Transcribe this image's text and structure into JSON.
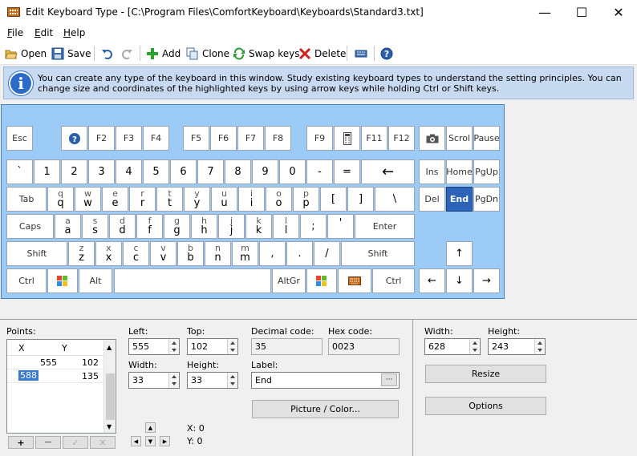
{
  "window": {
    "title": "Edit Keyboard Type - [C:\\Program Files\\ComfortKeyboard\\Keyboards\\Standard3.txt]",
    "minimize": "—",
    "maximize": "☐",
    "close": "✕"
  },
  "menu": {
    "file": "File",
    "edit": "Edit",
    "help": "Help"
  },
  "toolbar": {
    "open": "Open",
    "save": "Save",
    "add": "Add",
    "clone": "Clone",
    "swap": "Swap keys",
    "delete": "Delete"
  },
  "info": {
    "text": "You can create any type of the keyboard in this window. Study existing keyboard types to understand the setting principles. You can change size and coordinates of the highlighted keys by using arrow keys while holding Ctrl or Shift keys."
  },
  "keyboard": {
    "selected_key": "End",
    "background": "#9dcbf7",
    "selected_color": "#2d64b8"
  },
  "keys": {
    "esc": "Esc",
    "f1": "?",
    "f2": "F2",
    "f3": "F3",
    "f4": "F4",
    "f5": "F5",
    "f6": "F6",
    "f7": "F7",
    "f8": "F8",
    "f9": "F9",
    "f11": "F11",
    "f12": "F12",
    "scrol": "Scrol",
    "pause": "Pause",
    "grave": "`",
    "n1": "1",
    "n2": "2",
    "n3": "3",
    "n4": "4",
    "n5": "5",
    "n6": "6",
    "n7": "7",
    "n8": "8",
    "n9": "9",
    "n0": "0",
    "minus": "-",
    "equal": "=",
    "backspace": "←",
    "ins": "Ins",
    "home": "Home",
    "pgup": "PgUp",
    "tab": "Tab",
    "q": "q",
    "w": "w",
    "e": "e",
    "r": "r",
    "t": "t",
    "y": "y",
    "u": "u",
    "i": "i",
    "o": "o",
    "p": "p",
    "lbr": "[",
    "rbr": "]",
    "bslash": "\\",
    "del": "Del",
    "end": "End",
    "pgdn": "PgDn",
    "caps": "Caps",
    "a": "a",
    "s": "s",
    "d": "d",
    "f": "f",
    "g": "g",
    "h": "h",
    "j": "j",
    "k": "k",
    "l": "l",
    "semi": ";",
    "quote": "'",
    "enter": "Enter",
    "shift_l": "Shift",
    "z": "z",
    "x": "x",
    "c": "c",
    "v": "v",
    "b": "b",
    "n": "n",
    "m": "m",
    "comma": ",",
    "period": ".",
    "slash": "/",
    "shift_r": "Shift",
    "up": "↑",
    "ctrl_l": "Ctrl",
    "alt": "Alt",
    "altgr": "AltGr",
    "ctrl_r": "Ctrl",
    "left": "←",
    "down": "↓",
    "right": "→"
  },
  "points": {
    "label": "Points:",
    "col_x": "X",
    "col_y": "Y",
    "rows": [
      {
        "x": "555",
        "y": "102"
      },
      {
        "x": "588",
        "y": "135"
      }
    ],
    "add": "+",
    "remove": "—",
    "ok": "✓",
    "cancel": "✕"
  },
  "fields": {
    "left_label": "Left:",
    "left": "555",
    "top_label": "Top:",
    "top": "102",
    "width_label": "Width:",
    "width": "33",
    "height_label": "Height:",
    "height": "33",
    "dec_label": "Decimal code:",
    "dec": "35",
    "hex_label": "Hex code:",
    "hex": "0023",
    "label_label": "Label:",
    "label": "End",
    "more": "···",
    "picture": "Picture / Color...",
    "x_readout": "X: 0",
    "y_readout": "Y: 0"
  },
  "kb_size": {
    "width_label": "Width:",
    "width": "628",
    "height_label": "Height:",
    "height": "243",
    "resize": "Resize",
    "options": "Options"
  }
}
